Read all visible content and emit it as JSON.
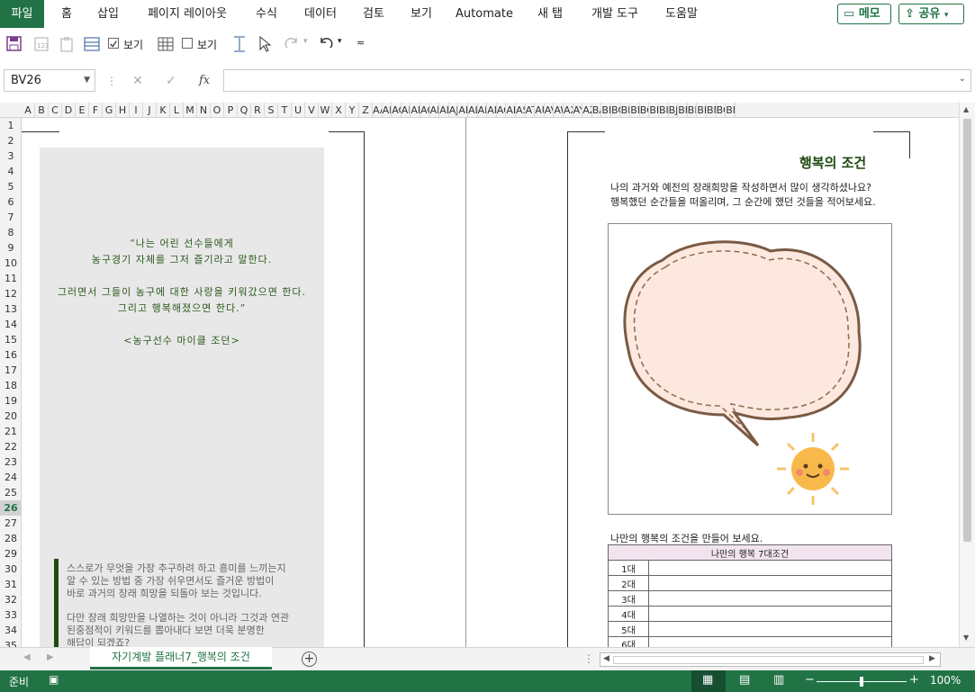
{
  "ribbon": {
    "tabs": [
      "파일",
      "홈",
      "삽입",
      "페이지 레이아웃",
      "수식",
      "데이터",
      "검토",
      "보기",
      "Automate",
      "새 탭",
      "개발 도구",
      "도움말"
    ],
    "memo_label": "메모",
    "share_label": "공유"
  },
  "toolbar": {
    "view_label_1": "보기",
    "view_label_2": "보기"
  },
  "formula": {
    "namebox": "BV26",
    "fx": "fx",
    "value": ""
  },
  "grid": {
    "columns": [
      "A",
      "B",
      "C",
      "D",
      "E",
      "F",
      "G",
      "H",
      "I",
      "J",
      "K",
      "L",
      "M",
      "N",
      "O",
      "P",
      "Q",
      "R",
      "S",
      "T",
      "U",
      "V",
      "W",
      "X",
      "Y",
      "Z",
      "AA",
      "AE",
      "AC",
      "AE",
      "AF",
      "AG",
      "AH",
      "AI",
      "AJ",
      "AK",
      "AL",
      "AM",
      "AN",
      "AC",
      "AF",
      "AS",
      "AT",
      "AU",
      "AV",
      "AW",
      "AX",
      "AY",
      "AZ",
      "BA",
      "BE",
      "BC",
      "BE",
      "BF",
      "BG",
      "BH",
      "BI",
      "BJ",
      "BK",
      "BL",
      "BM",
      "BN",
      "BC",
      "BF"
    ],
    "rows": [
      "1",
      "2",
      "3",
      "4",
      "5",
      "6",
      "7",
      "8",
      "9",
      "10",
      "11",
      "12",
      "13",
      "14",
      "15",
      "16",
      "17",
      "18",
      "19",
      "20",
      "21",
      "22",
      "23",
      "24",
      "25",
      "26",
      "27",
      "28",
      "29",
      "30",
      "31",
      "32",
      "33",
      "34",
      "35"
    ],
    "selected_row": "26"
  },
  "left_page": {
    "quote_lines": [
      "“나는 어린 선수들에게",
      "농구경기 자체를 그저 즐기라고 말한다.",
      "",
      "그러면서 그들이 농구에 대한 사랑을 키워갔으면 한다.",
      "그리고 행복해졌으면 한다.”",
      "",
      "<농구선수 마이클 조던>"
    ],
    "body_lines": [
      "스스로가 무엇을 가장 추구하려 하고 흥미를 느끼는지",
      "알 수 있는 방법 중 가장 쉬우면서도 즐거운 방법이",
      "바로 과거의 장래 희망을 되돌아 보는 것입니다.",
      "",
      "다만 장래 희망만을 나열하는 것이 아니라 그것과 연관",
      "된중점적이 키워드를 뽑아내다 보면 더욱 분명한",
      "해답이 되겠죠?"
    ]
  },
  "right_page": {
    "title": "행복의 조건",
    "intro_1": "나의 과거와 예전의 장래희망을 작성하면서 많이 생각하셨나요?",
    "intro_2": "행복했던 순간들을 떠올리며, 그 순간에 했던 것들을 적어보세요.",
    "make_label": "나만의 행복의 조건을 만들어 보세요.",
    "table_header": "나만의 행복 7대조건",
    "table_rows": [
      "1대",
      "2대",
      "3대",
      "4대",
      "5대",
      "6대"
    ]
  },
  "sheet_tabs": {
    "active": "자기계발 플래너7_행복의 조건"
  },
  "status": {
    "ready": "준비",
    "zoom": "100%"
  },
  "colors": {
    "excel_green": "#217346",
    "quote_green": "#2d5a1e",
    "panel_gray": "#e8e8e8",
    "bubble_fill": "#fce8de",
    "bubble_stroke": "#7a5a44",
    "table_header_bg": "#f2e4ef"
  }
}
